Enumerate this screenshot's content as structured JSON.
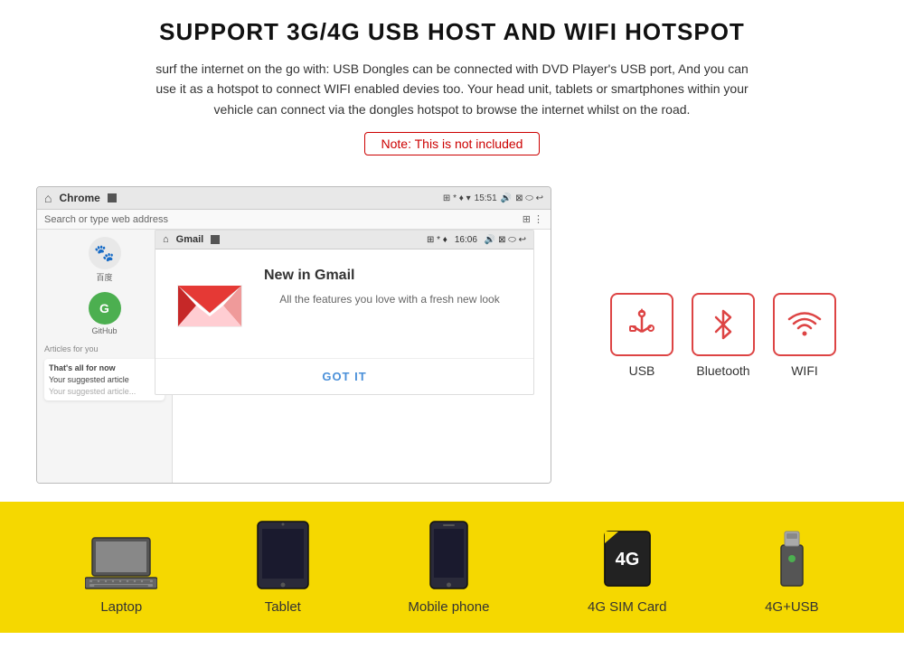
{
  "header": {
    "title": "SUPPORT 3G/4G USB HOST AND WIFI HOTSPOT",
    "subtitle": "surf the internet on the go with: USB Dongles can be connected with DVD Player's USB port, And you can use it as a hotspot to connect WIFI enabled devies too. Your head unit, tablets or smartphones within your vehicle can connect via the dongles hotspot to browse the internet whilst on the road.",
    "note": "Note: This is not included"
  },
  "browser": {
    "app1": "Chrome",
    "app2": "Gmail",
    "time1": "15:51",
    "time2": "16:06",
    "address": "Search or type web address",
    "baidu_label": "百度",
    "github_label": "GitHub",
    "articles_label": "Articles for you",
    "card_title": "That's all for now",
    "card_subtitle": "Your suggested article",
    "gmail_new": "New in Gmail",
    "gmail_desc": "All the features you love with a fresh new look",
    "got_it": "GOT IT"
  },
  "connectivity_icons": [
    {
      "id": "usb",
      "label": "USB",
      "icon": "usb"
    },
    {
      "id": "bluetooth",
      "label": "Bluetooth",
      "icon": "bluetooth"
    },
    {
      "id": "wifi",
      "label": "WIFI",
      "icon": "wifi"
    }
  ],
  "devices": [
    {
      "id": "laptop",
      "label": "Laptop"
    },
    {
      "id": "tablet",
      "label": "Tablet"
    },
    {
      "id": "phone",
      "label": "Mobile phone"
    },
    {
      "id": "sim",
      "label": "4G SIM Card"
    },
    {
      "id": "usb_drive",
      "label": "4G+USB"
    }
  ],
  "colors": {
    "accent": "#d44",
    "yellow": "#f5d800"
  }
}
